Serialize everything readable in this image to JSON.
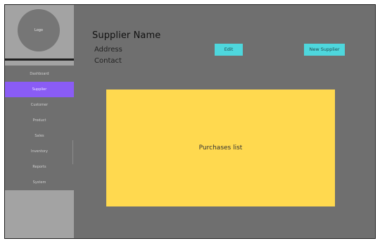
{
  "logo": {
    "text": "Logo"
  },
  "nav": {
    "items": [
      {
        "label": "Dashboard"
      },
      {
        "label": "Supplier",
        "active": true
      },
      {
        "label": "Customer"
      },
      {
        "label": "Product"
      },
      {
        "label": "Sales"
      },
      {
        "label": "Inventory"
      },
      {
        "label": "Reports"
      },
      {
        "label": "System"
      }
    ]
  },
  "supplier": {
    "name": "Supplier Name",
    "address": "Address",
    "contact": "Contact"
  },
  "toolbar": {
    "edit_label": "Edit",
    "new_supplier_label": "New Supplier"
  },
  "purchases": {
    "label": "Purchases list"
  },
  "colors": {
    "background": "#6f6f6f",
    "sidebar_panel": "#a3a3a3",
    "active_nav": "#8a5cf5",
    "button": "#4ed7dd",
    "purchases_panel": "#ffd94f"
  }
}
